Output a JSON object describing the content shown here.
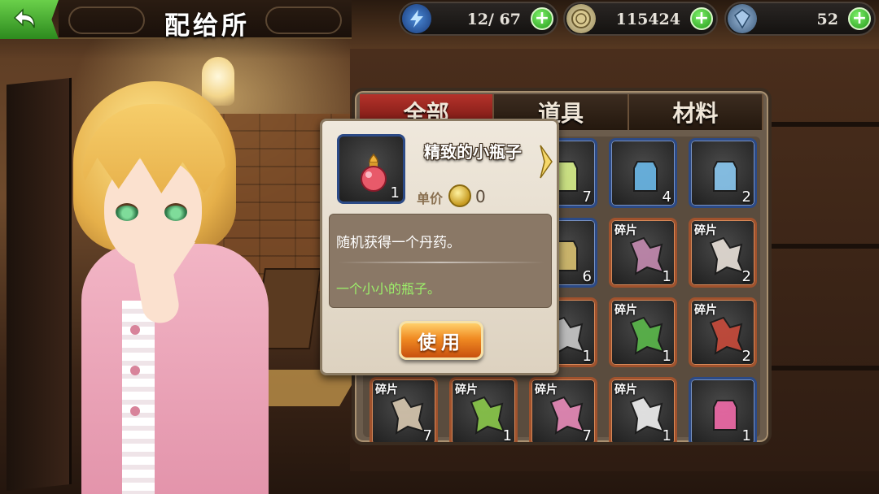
{
  "header": {
    "title": "配给所",
    "back_icon": "back-arrow-icon",
    "back_color": "#3fb02a"
  },
  "resources": {
    "energy": {
      "icon": "lightning-icon",
      "value": "12/ 67",
      "current": 12,
      "max": 67
    },
    "gold": {
      "icon": "coin-icon",
      "value": "115424"
    },
    "gems": {
      "icon": "crystal-icon",
      "value": "52"
    },
    "add_icon": "plus-icon",
    "add_label": "+"
  },
  "inventory": {
    "tabs": [
      {
        "label": "全部",
        "active": true
      },
      {
        "label": "道具",
        "active": false
      },
      {
        "label": "材料",
        "active": false
      }
    ],
    "items": [
      {
        "kind": "item",
        "icon": "glow-stick-icon",
        "count": "7",
        "art": "#d8f08a"
      },
      {
        "kind": "item",
        "icon": "potion-bottle-icon",
        "count": "4",
        "art": "#6ab8e8"
      },
      {
        "kind": "item",
        "icon": "water-drop-flask-icon",
        "count": "2",
        "art": "#8ac8f0"
      },
      {
        "kind": "item",
        "icon": "crumpled-paper-icon",
        "count": "6",
        "art": "#d8c070"
      },
      {
        "kind": "shard",
        "label": "碎片",
        "icon": "dark-armor-shard-icon",
        "count": "1",
        "art": "#c48ab0"
      },
      {
        "kind": "shard",
        "label": "碎片",
        "icon": "white-armor-shard-icon",
        "count": "2",
        "art": "#e8e0d8"
      },
      {
        "kind": "shard",
        "label": "碎片",
        "icon": "grey-shard-icon",
        "count": "1",
        "art": "#c8c8c8"
      },
      {
        "kind": "shard",
        "label": "碎片",
        "icon": "green-armor-shard-icon",
        "count": "1",
        "art": "#5ab84a"
      },
      {
        "kind": "shard",
        "label": "碎片",
        "icon": "red-armor-shard-icon",
        "count": "2",
        "art": "#c84a3a"
      },
      {
        "kind": "shard",
        "label": "碎片",
        "icon": "bone-shard-icon",
        "count": "7",
        "art": "#d8c8b0"
      },
      {
        "kind": "shard",
        "label": "碎片",
        "icon": "green-lace-shard-icon",
        "count": "1",
        "art": "#8ac84a"
      },
      {
        "kind": "shard",
        "label": "碎片",
        "icon": "pink-lace-shard-icon",
        "count": "7",
        "art": "#e88ab8"
      },
      {
        "kind": "shard",
        "label": "碎片",
        "icon": "white-lace-shard-icon",
        "count": "1",
        "art": "#f0f0f0"
      },
      {
        "kind": "item",
        "icon": "pink-candy-icon",
        "count": "1",
        "art": "#f06aa8"
      }
    ]
  },
  "tooltip": {
    "name": "精致的小瓶子",
    "icon": "small-bottle-icon",
    "count": "1",
    "price_label": "单价",
    "price_icon": "coin-icon",
    "price": "0",
    "description": "随机获得一个丹药。",
    "flavor": "一个小小的瓶子。",
    "use_label": "使用",
    "next_icon": "chevron-right-icon",
    "flavor_color": "#9cf06a"
  }
}
